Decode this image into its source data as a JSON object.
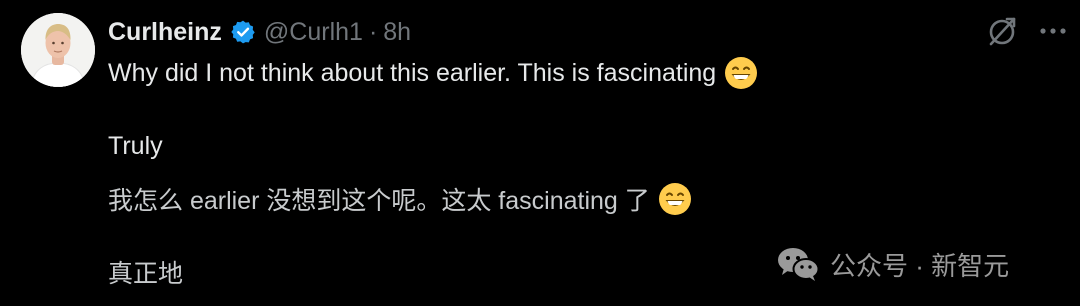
{
  "author": {
    "display_name": "Curlheinz",
    "handle": "@Curlh1",
    "separator": "·",
    "timestamp": "8h",
    "verified": true,
    "avatar_icon": "profile-photo"
  },
  "actions": {
    "grok_icon": "grok-icon",
    "more_icon": "more-horizontal-icon"
  },
  "post": {
    "line1": "Why did I not think about this earlier. This is fascinating",
    "line2": "Truly",
    "line3": "我怎么 earlier 没想到这个呢。这太 fascinating 了",
    "line4": "真正地",
    "emoji": "grinning-face-with-smiling-eyes"
  },
  "watermark": {
    "text": "公众号 · 新智元",
    "icon": "wechat-icon"
  },
  "colors": {
    "background": "#000000",
    "text": "#e7e9ea",
    "secondary": "#71767b",
    "verified_blue": "#1d9bf0",
    "emoji_yellow": "#ffcc4d"
  }
}
